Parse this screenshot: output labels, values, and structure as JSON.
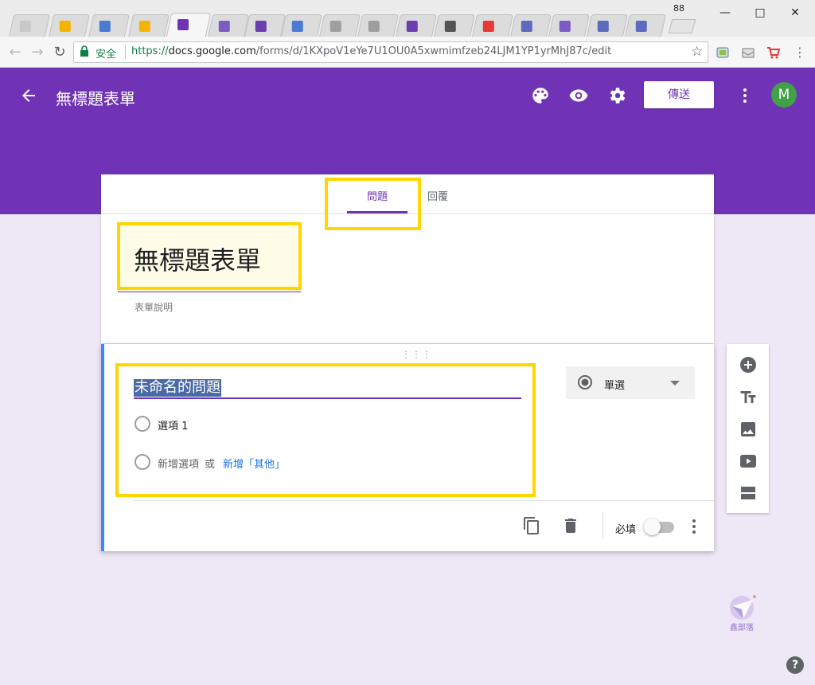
{
  "browser": {
    "tab_count": "88",
    "secure_label": "安全",
    "url_scheme": "https://",
    "url_host": "docs.google.com",
    "url_path": "/forms/d/1KXpoV1eYe7U1OU0A5xwmimfzeb24LJM1YP1yrMhJ87c/edit"
  },
  "header": {
    "form_name": "無標題表單",
    "send_label": "傳送",
    "avatar_initial": "M",
    "accent_color": "#7133b5"
  },
  "tabs": {
    "questions": "問題",
    "responses": "回覆"
  },
  "form": {
    "title": "無標題表單",
    "description_placeholder": "表單說明"
  },
  "question": {
    "title": "未命名的問題",
    "type": "單選",
    "options": [
      "選項 1"
    ],
    "add_option": "新增選項",
    "or": "或",
    "add_other": "新增「其他」",
    "required_label": "必填"
  },
  "watermark_text": "鑫部落",
  "help_label": "?"
}
